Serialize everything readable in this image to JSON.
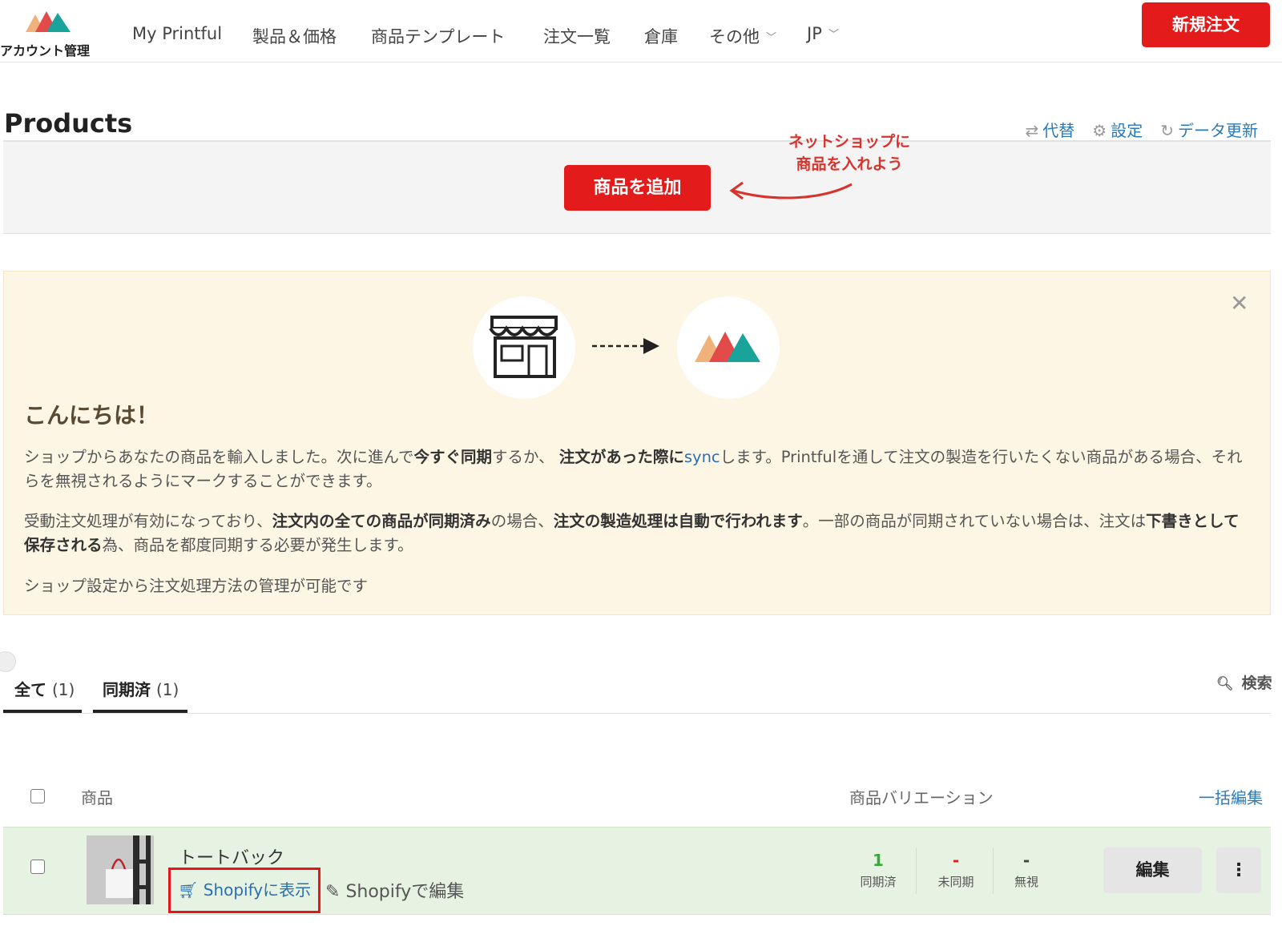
{
  "header": {
    "logo_text": "アカウント管理",
    "nav": [
      "My Printful",
      "製品＆価格",
      "商品テンプレート",
      "注文一覧",
      "倉庫",
      "その他",
      "JP"
    ],
    "new_order": "新規注文"
  },
  "page": {
    "title": "Products",
    "links": {
      "alternate": "代替",
      "settings": "設定",
      "refresh": "データ更新"
    },
    "add_product": "商品を追加",
    "hint_line1": "ネットショップに",
    "hint_line2": "商品を入れよう"
  },
  "banner": {
    "greeting": "こんにちは！",
    "p1_a": "ショップからあなたの商品を輸入しました。次に進んで",
    "p1_b": "今すぐ同期",
    "p1_c": "するか、 ",
    "p1_d": "注文があった際に",
    "p1_link": "sync",
    "p1_e": "します。Printfulを通して注文の製造を行いたくない商品がある場合、それらを無視されるようにマークすることができます。",
    "p2_a": "受動注文処理が有効になっており、",
    "p2_b": "注文内の全ての商品が同期済み",
    "p2_c": "の場合、",
    "p2_d": "注文の製造処理は自動で行われます",
    "p2_e": "。一部の商品が同期されていない場合は、注文は",
    "p2_f": "下書きとして保存される",
    "p2_g": "為、商品を都度同期する必要が発生します。",
    "p3": "ショップ設定から注文処理方法の管理が可能です"
  },
  "tabs": [
    {
      "label": "全て",
      "count": "(1)"
    },
    {
      "label": "同期済",
      "count": "(1)"
    }
  ],
  "search_label": "検索",
  "table": {
    "col_product": "商品",
    "col_variations": "商品バリエーション",
    "bulk_edit": "一括編集",
    "rows": [
      {
        "name": "トートバック",
        "view_on_shopify": "Shopifyに表示",
        "edit_on_shopify": "Shopifyで編集",
        "synced_value": "1",
        "synced_label": "同期済",
        "unsynced_value": "-",
        "unsynced_label": "未同期",
        "ignored_value": "-",
        "ignored_label": "無視",
        "edit": "編集",
        "more": "⋮"
      }
    ]
  },
  "colors": {
    "accent": "#e31b1b",
    "link": "#2a7ab8",
    "banner_bg": "#fdf6e4",
    "row_bg": "#e6f3e2",
    "synced": "#3aa83a"
  }
}
